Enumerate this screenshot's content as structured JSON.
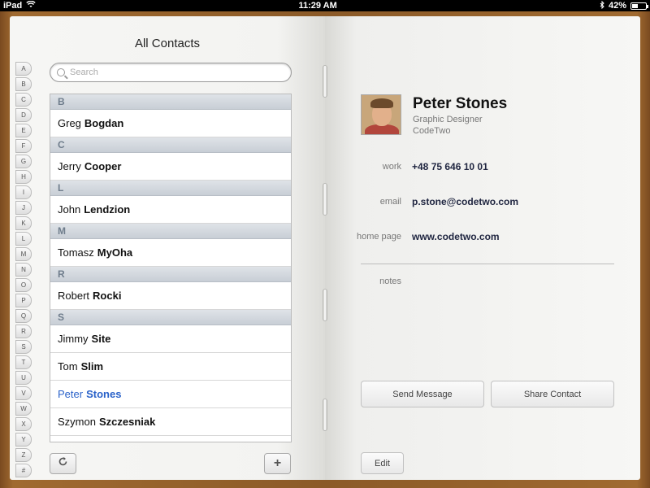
{
  "status_bar": {
    "device": "iPad",
    "time": "11:29 AM",
    "battery": "42%",
    "battery_level": 0.42
  },
  "left_page": {
    "title": "All Contacts",
    "search": {
      "placeholder": "Search"
    },
    "alpha_index": [
      "A",
      "B",
      "C",
      "D",
      "E",
      "F",
      "G",
      "H",
      "I",
      "J",
      "K",
      "L",
      "M",
      "N",
      "O",
      "P",
      "Q",
      "R",
      "S",
      "T",
      "U",
      "V",
      "W",
      "X",
      "Y",
      "Z",
      "#"
    ],
    "sections": [
      {
        "letter": "B",
        "contacts": [
          {
            "first": "Greg",
            "last": "Bogdan"
          }
        ]
      },
      {
        "letter": "C",
        "contacts": [
          {
            "first": "Jerry",
            "last": "Cooper"
          }
        ]
      },
      {
        "letter": "L",
        "contacts": [
          {
            "first": "John",
            "last": "Lendzion"
          }
        ]
      },
      {
        "letter": "M",
        "contacts": [
          {
            "first": "Tomasz",
            "last": "MyOha"
          }
        ]
      },
      {
        "letter": "R",
        "contacts": [
          {
            "first": "Robert",
            "last": "Rocki"
          }
        ]
      },
      {
        "letter": "S",
        "contacts": [
          {
            "first": "Jimmy",
            "last": "Site"
          },
          {
            "first": "Tom",
            "last": "Slim"
          },
          {
            "first": "Peter",
            "last": "Stones",
            "selected": true
          },
          {
            "first": "Szymon",
            "last": "Szczesniak"
          }
        ]
      }
    ],
    "refresh_icon": "refresh-icon",
    "add_label": "+"
  },
  "right_page": {
    "name": "Peter Stones",
    "job_title": "Graphic Designer",
    "company": "CodeTwo",
    "fields": {
      "work_label": "work",
      "work_value": "+48 75 646 10 01",
      "email_label": "email",
      "email_value": "p.stone@codetwo.com",
      "homepage_label": "home page",
      "homepage_value": "www.codetwo.com",
      "notes_label": "notes"
    },
    "buttons": {
      "send_message": "Send Message",
      "share_contact": "Share Contact",
      "edit": "Edit"
    }
  },
  "colors": {
    "selected_text": "#2a62c9",
    "section_header_text": "#6f7d8c"
  }
}
